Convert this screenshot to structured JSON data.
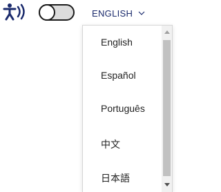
{
  "header": {
    "accessibility_icon": "accessibility-audio-icon",
    "toggle_state": "off",
    "language_button_label": "ENGLISH",
    "chevron_icon": "chevron-down-icon",
    "accent_color": "#1a2a6c"
  },
  "dropdown": {
    "options": [
      {
        "label": "English"
      },
      {
        "label": "Español"
      },
      {
        "label": "Português"
      },
      {
        "label": "中文"
      },
      {
        "label": "日本語"
      }
    ]
  }
}
